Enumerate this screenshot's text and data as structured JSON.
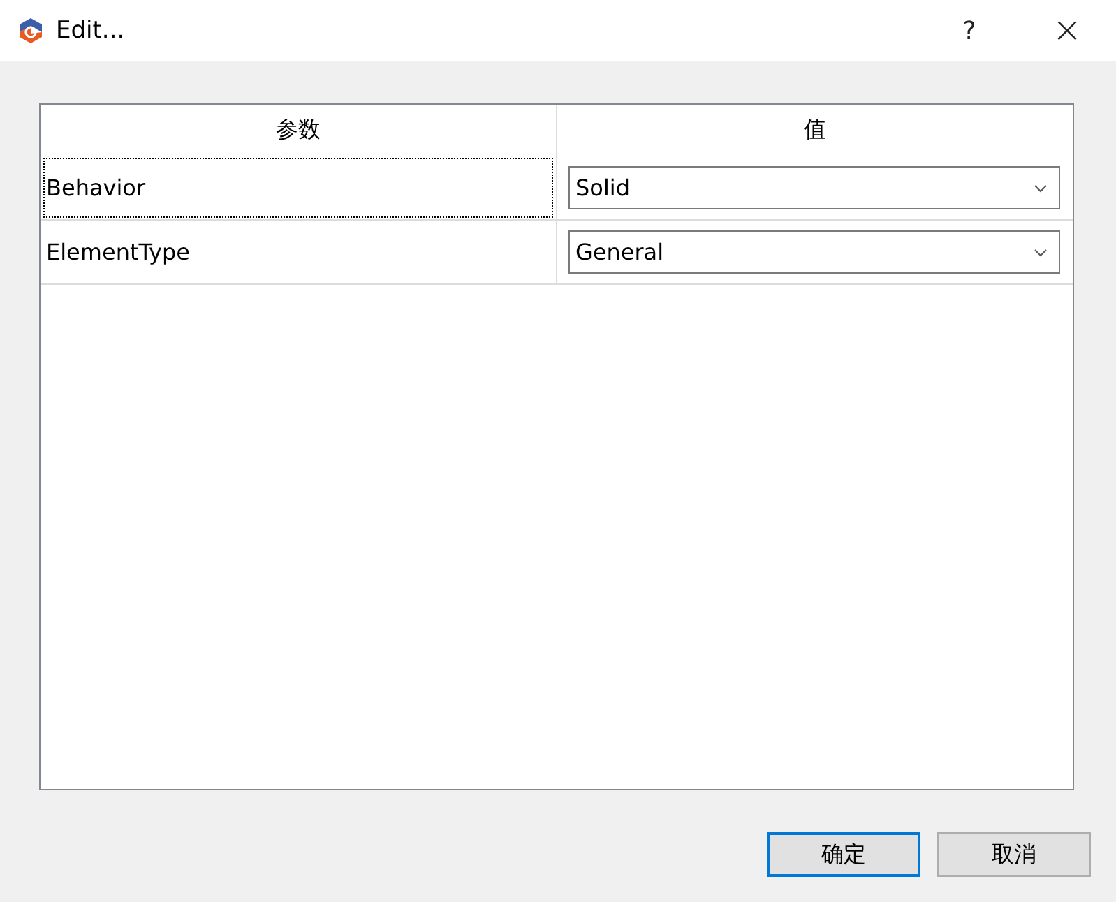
{
  "window": {
    "title": "Edit...",
    "help": "?",
    "close": "×"
  },
  "table": {
    "columns": [
      "参数",
      "值"
    ],
    "rows": [
      {
        "parameter": "Behavior",
        "value": "Solid",
        "focused": true
      },
      {
        "parameter": "ElementType",
        "value": "General",
        "focused": false
      }
    ]
  },
  "buttons": [
    {
      "label": "确定",
      "default": true
    },
    {
      "label": "取消",
      "default": false
    }
  ]
}
